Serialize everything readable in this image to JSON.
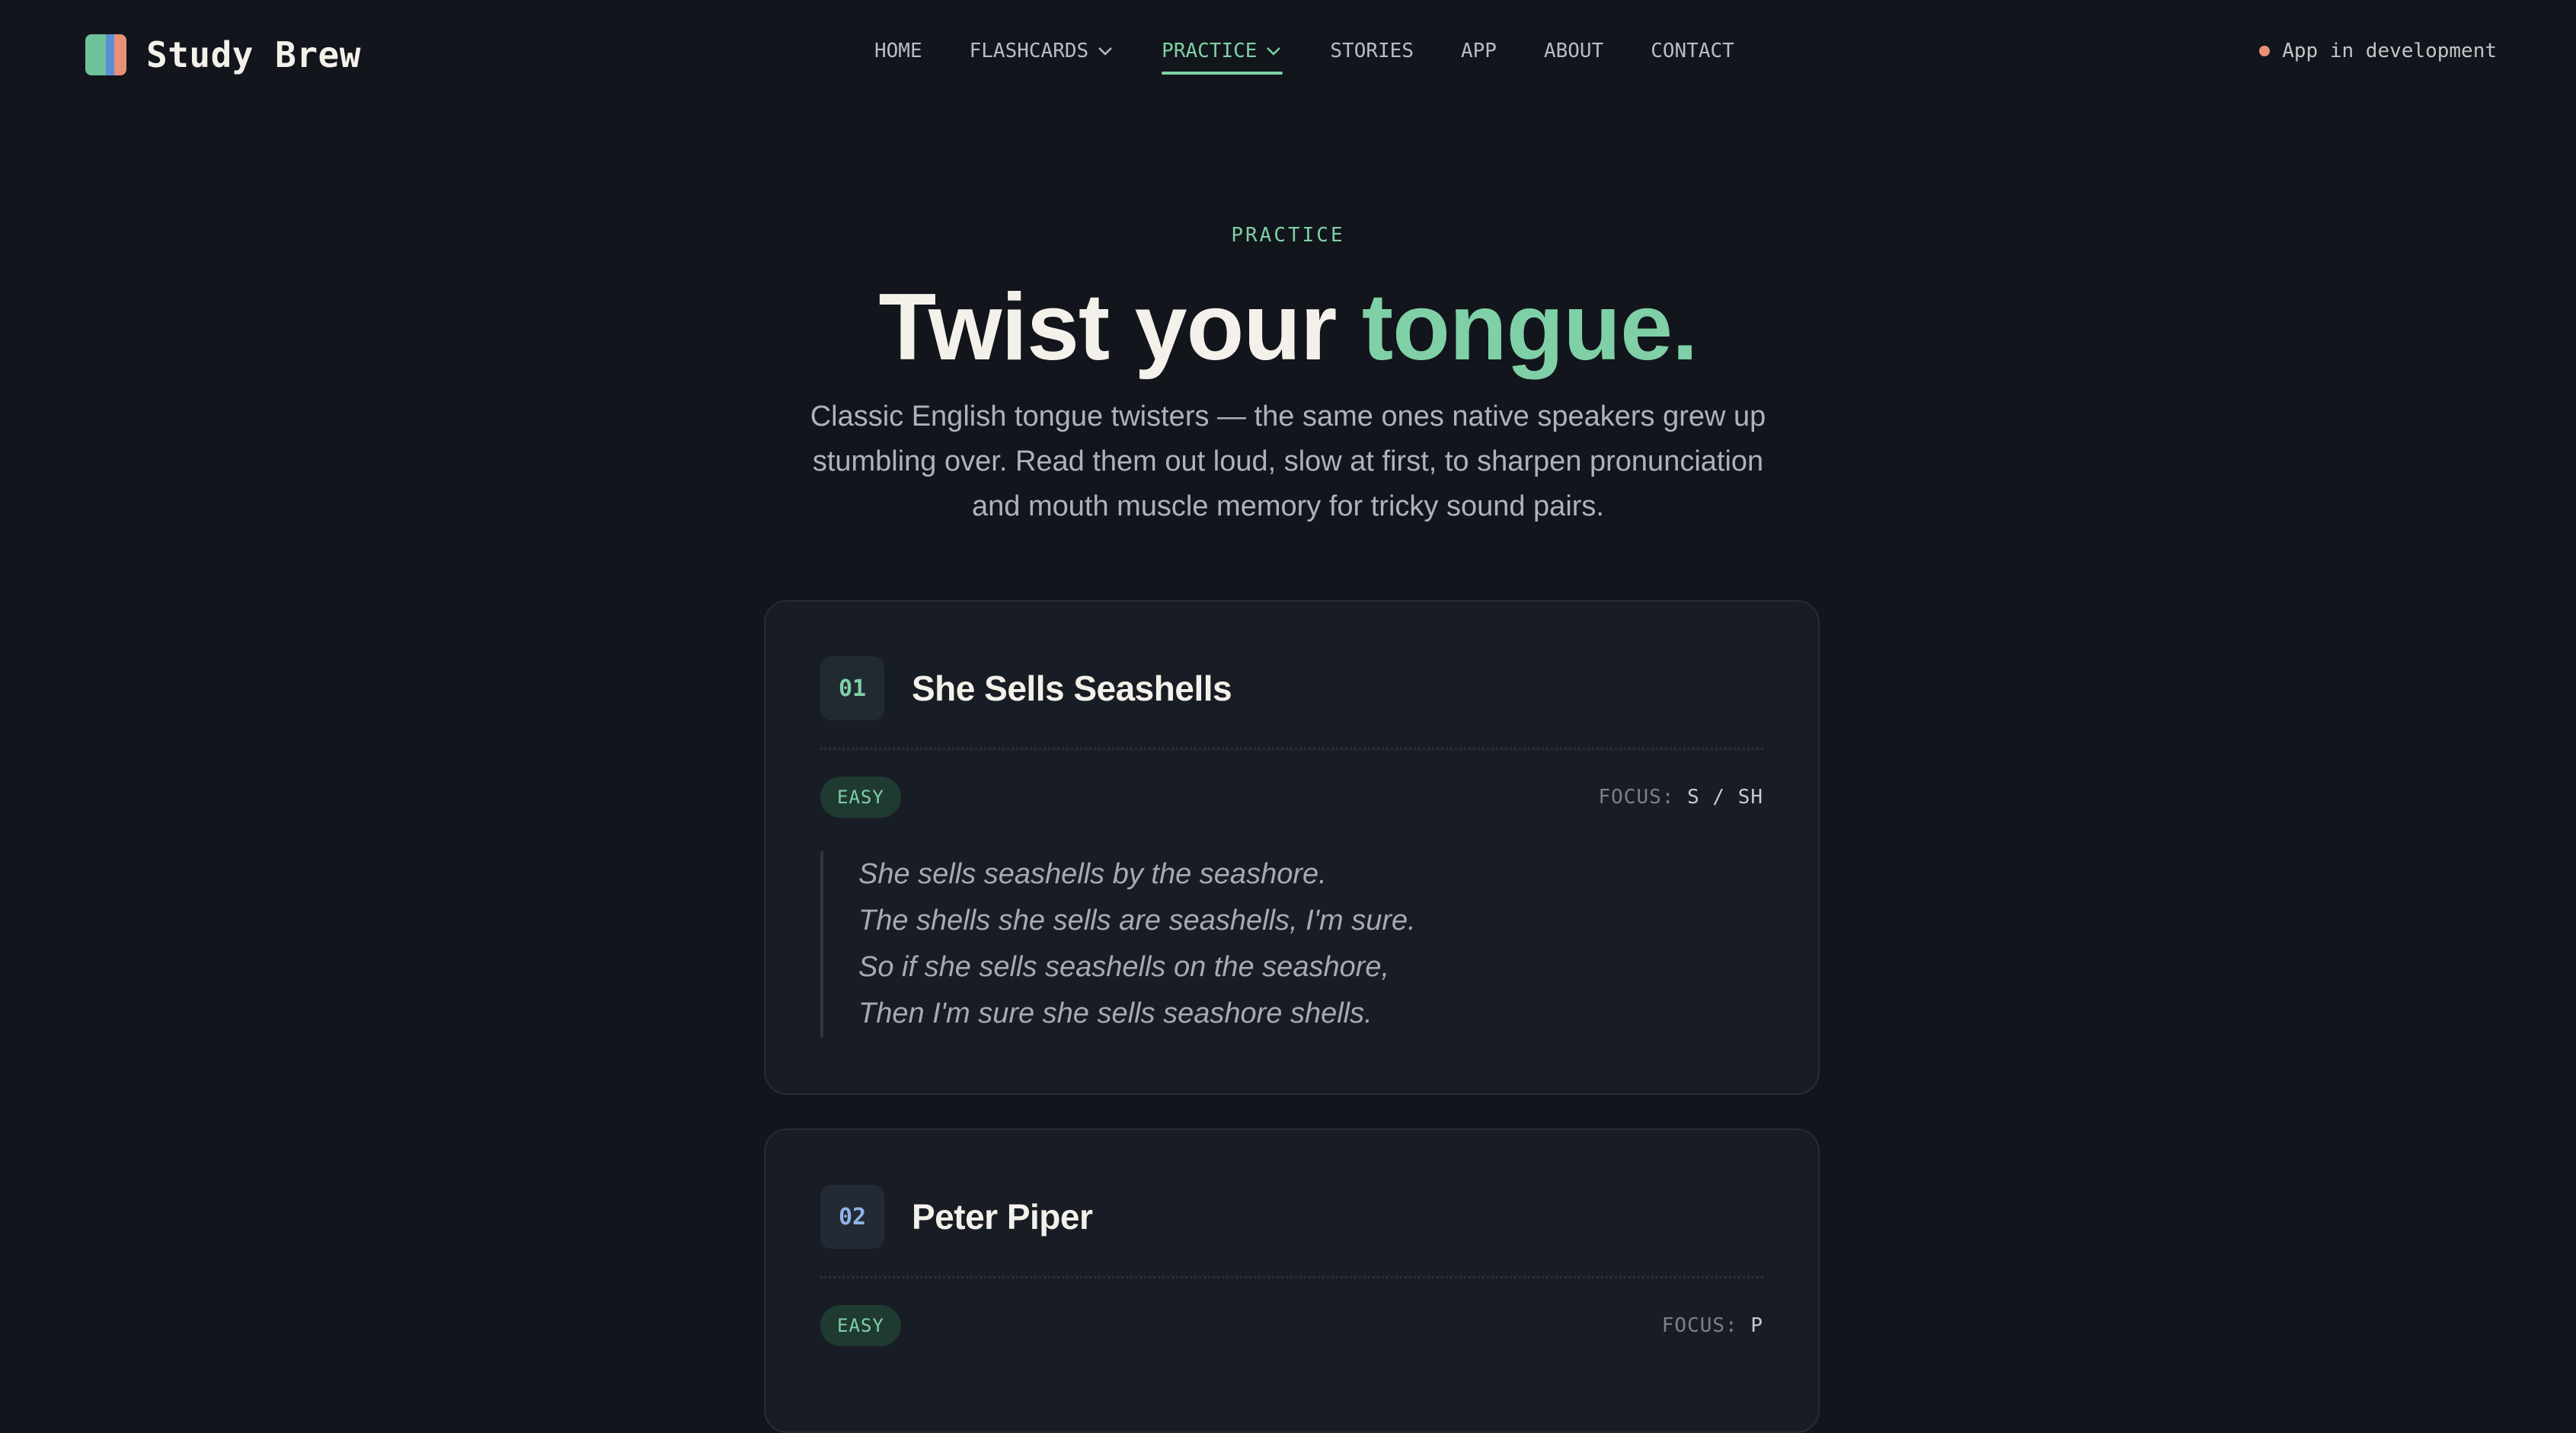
{
  "brand": {
    "name": "Study Brew"
  },
  "nav": {
    "items": [
      {
        "label": "HOME",
        "dropdown": false,
        "active": false
      },
      {
        "label": "FLASHCARDS",
        "dropdown": true,
        "active": false
      },
      {
        "label": "PRACTICE",
        "dropdown": true,
        "active": true
      },
      {
        "label": "STORIES",
        "dropdown": false,
        "active": false
      },
      {
        "label": "APP",
        "dropdown": false,
        "active": false
      },
      {
        "label": "ABOUT",
        "dropdown": false,
        "active": false
      },
      {
        "label": "CONTACT",
        "dropdown": false,
        "active": false
      }
    ]
  },
  "status": {
    "label": "App in development",
    "color": "#e8917a"
  },
  "hero": {
    "eyebrow": "PRACTICE",
    "title_main": "Twist your ",
    "title_accent": "tongue.",
    "description": "Classic English tongue twisters — the same ones native speakers grew up stumbling over. Read them out loud, slow at first, to sharpen pronunciation and mouth muscle memory for tricky sound pairs."
  },
  "colors": {
    "background": "#12151b",
    "accent": "#7fd0a6",
    "card": "#181d25"
  },
  "cards": [
    {
      "number": "01",
      "title": "She Sells Seashells",
      "difficulty": "EASY",
      "focus_label": "FOCUS:",
      "focus_value": "S / SH",
      "lines": [
        "She sells seashells by the seashore.",
        "The shells she sells are seashells, I'm sure.",
        "So if she sells seashells on the seashore,",
        "Then I'm sure she sells seashore shells."
      ]
    },
    {
      "number": "02",
      "title": "Peter Piper",
      "difficulty": "EASY",
      "focus_label": "FOCUS:",
      "focus_value": "P"
    }
  ]
}
